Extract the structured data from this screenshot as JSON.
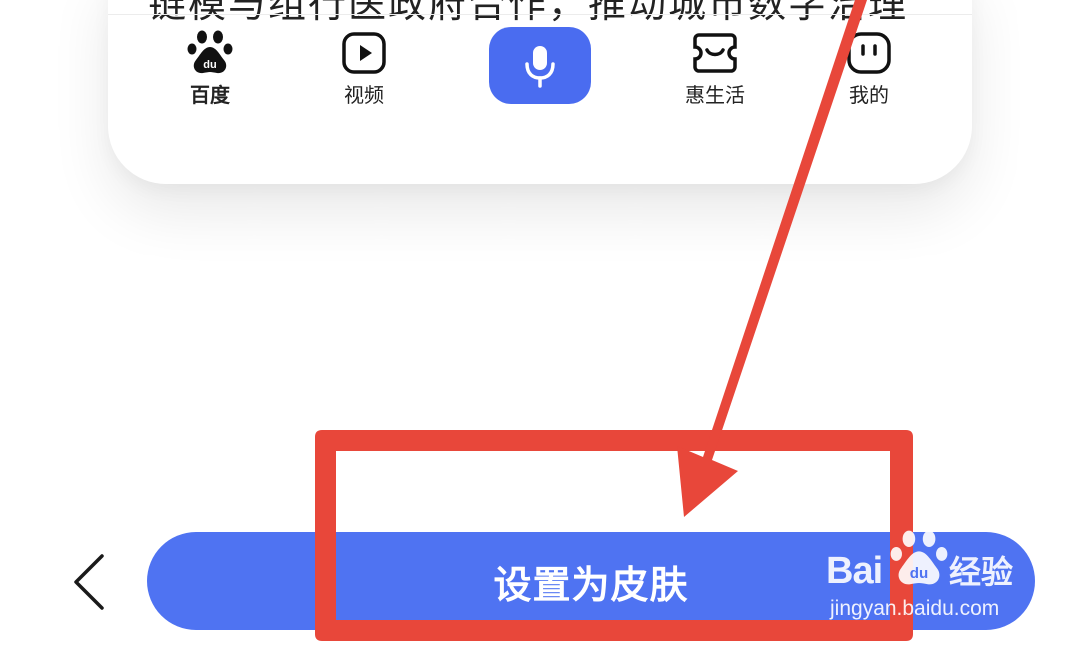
{
  "preview": {
    "clipped_text": "链模与组行医政府合作，推动城市数字治理"
  },
  "tabs": [
    {
      "label": "百度",
      "icon": "baidu-paw-icon",
      "active": true
    },
    {
      "label": "视频",
      "icon": "play-square-icon"
    },
    {
      "label": "惠生活",
      "icon": "ticket-smile-icon"
    },
    {
      "label": "我的",
      "icon": "face-icon"
    }
  ],
  "mic": {
    "icon": "microphone-icon",
    "color": "#4a6cf0"
  },
  "primary_button": {
    "label": "设置为皮肤",
    "color": "#4f73f2"
  },
  "back": {
    "icon": "chevron-left-icon"
  },
  "annotation": {
    "color": "#e8473a",
    "shapes": [
      "highlight-rectangle",
      "pointer-arrow"
    ]
  },
  "watermark": {
    "brand": "Bai",
    "paw_text": "du",
    "suffix": "经验",
    "url": "jingyan.baidu.com"
  }
}
